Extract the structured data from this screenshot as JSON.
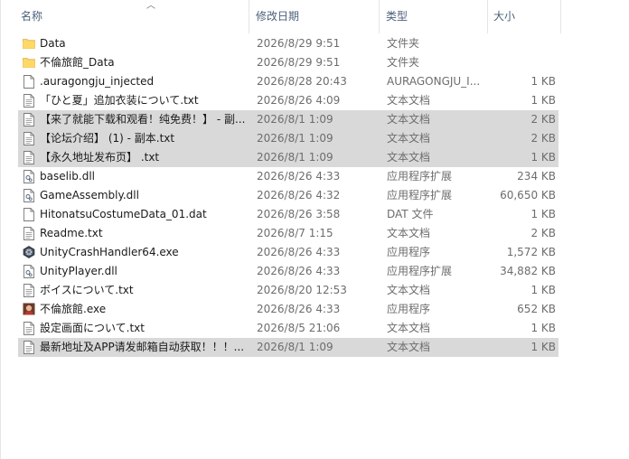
{
  "columns": {
    "name": "名称",
    "date": "修改日期",
    "type": "类型",
    "size": "大小"
  },
  "colors": {
    "header_text": "#4c607a",
    "selected_bg": "#d9d9d9",
    "folder": "#f8d775"
  },
  "files": [
    {
      "name": "Data",
      "date": "2026/8/29 9:51",
      "type": "文件夹",
      "size": "",
      "icon": "folder-icon",
      "selected": false
    },
    {
      "name": "不倫旅館_Data",
      "date": "2026/8/29 9:51",
      "type": "文件夹",
      "size": "",
      "icon": "folder-icon",
      "selected": false
    },
    {
      "name": ".auragongju_injected",
      "date": "2026/8/28 20:43",
      "type": "AURAGONGJU_I...",
      "size": "1 KB",
      "icon": "file-icon",
      "selected": false
    },
    {
      "name": "「ひと夏」追加衣装について.txt",
      "date": "2026/8/26 4:09",
      "type": "文本文档",
      "size": "1 KB",
      "icon": "text-file-icon",
      "selected": false
    },
    {
      "name": "【来了就能下载和观看！纯免费！】 - 副...",
      "date": "2026/8/1 1:09",
      "type": "文本文档",
      "size": "2 KB",
      "icon": "text-file-icon",
      "selected": true
    },
    {
      "name": "【论坛介绍】 (1) - 副本.txt",
      "date": "2026/8/1 1:09",
      "type": "文本文档",
      "size": "2 KB",
      "icon": "text-file-icon",
      "selected": true
    },
    {
      "name": "【永久地址发布页】 .txt",
      "date": "2026/8/1 1:09",
      "type": "文本文档",
      "size": "1 KB",
      "icon": "text-file-icon",
      "selected": true
    },
    {
      "name": "baselib.dll",
      "date": "2026/8/26 4:33",
      "type": "应用程序扩展",
      "size": "234 KB",
      "icon": "dll-file-icon",
      "selected": false
    },
    {
      "name": "GameAssembly.dll",
      "date": "2026/8/26 4:32",
      "type": "应用程序扩展",
      "size": "60,650 KB",
      "icon": "dll-file-icon",
      "selected": false
    },
    {
      "name": "HitonatsuCostumeData_01.dat",
      "date": "2026/8/26 3:58",
      "type": "DAT 文件",
      "size": "1 KB",
      "icon": "file-icon",
      "selected": false
    },
    {
      "name": "Readme.txt",
      "date": "2026/8/7 1:15",
      "type": "文本文档",
      "size": "2 KB",
      "icon": "text-file-icon",
      "selected": false
    },
    {
      "name": "UnityCrashHandler64.exe",
      "date": "2026/8/26 4:33",
      "type": "应用程序",
      "size": "1,572 KB",
      "icon": "unity-icon",
      "selected": false
    },
    {
      "name": "UnityPlayer.dll",
      "date": "2026/8/26 4:33",
      "type": "应用程序扩展",
      "size": "34,882 KB",
      "icon": "dll-file-icon",
      "selected": false
    },
    {
      "name": "ボイスについて.txt",
      "date": "2026/8/20 12:53",
      "type": "文本文档",
      "size": "1 KB",
      "icon": "text-file-icon",
      "selected": false
    },
    {
      "name": "不倫旅館.exe",
      "date": "2026/8/26 4:33",
      "type": "应用程序",
      "size": "652 KB",
      "icon": "game-app-icon",
      "selected": false
    },
    {
      "name": "設定画面について.txt",
      "date": "2026/8/5 21:06",
      "type": "文本文档",
      "size": "1 KB",
      "icon": "text-file-icon",
      "selected": false
    },
    {
      "name": "最新地址及APP请发邮箱自动获取！！！...",
      "date": "2026/8/1 1:09",
      "type": "文本文档",
      "size": "1 KB",
      "icon": "text-file-icon",
      "selected": true
    }
  ]
}
